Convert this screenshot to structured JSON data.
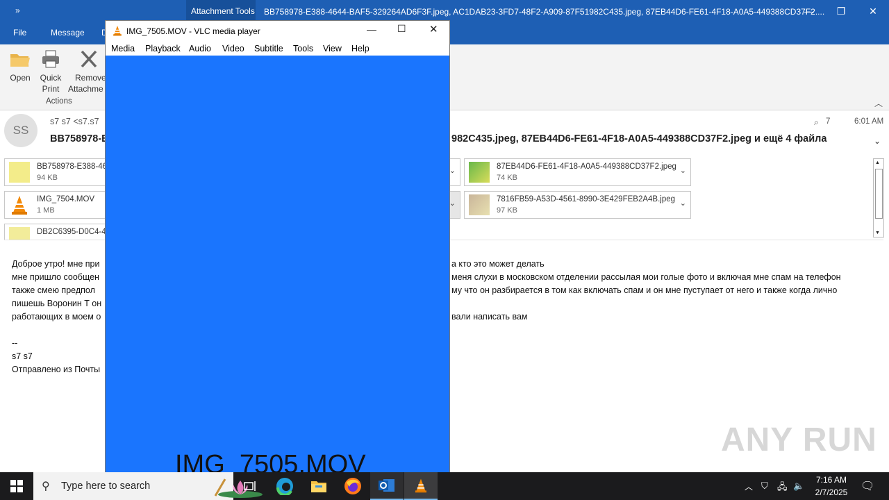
{
  "outlook": {
    "context_tab": "Attachment Tools",
    "window_title": "BB758978-E388-4644-BAF5-329264AD6F3F.jpeg, AC1DAB23-3FD7-48F2-A909-87F51982C435.jpeg, 87EB44D6-FE61-4F18-A0A5-449388CD37F2....",
    "tabs": [
      "File",
      "Message",
      "D"
    ],
    "ribbon": {
      "open": "Open",
      "quick_print_1": "Quick",
      "quick_print_2": "Print",
      "remove_1": "Remove",
      "remove_2": "Attachme",
      "group": "Actions"
    },
    "header": {
      "avatar": "SS",
      "from": "s7 s7 <s7.s7",
      "subject_left": "BB758978-E",
      "subject_right": "982C435.jpeg, 87EB44D6-FE61-4F18-A0A5-449388CD37F2.jpeg и ещё 4 файла",
      "attach_count": "7",
      "time": "6:01 AM"
    },
    "attachments": [
      {
        "name": "BB758978-E388-464",
        "size": "94 KB"
      },
      {
        "name": "IMG_7504.MOV",
        "size": "1 MB"
      },
      {
        "name": "DB2C6395-D0C4-4",
        "size": ""
      },
      {
        "name": "87EB44D6-FE61-4F18-A0A5-449388CD37F2.jpeg",
        "size": "74 KB"
      },
      {
        "name": "7816FB59-A53D-4561-8990-3E429FEB2A4B.jpeg",
        "size": "97 KB"
      }
    ],
    "body": {
      "l1a": "Доброе утро! мне при",
      "l1b": "а кто это может делать",
      "l2a": "мне пришло сообщен",
      "l2b": "меня слухи в  московском отделении рассылая мои голые фото и включая мне спам на телефон",
      "l3a": "также смею предпол",
      "l3b": "му что он разбирается в том как включать спам и он мне пуступает от него и также когда лично",
      "l4a": "пишешь Воронин Т он",
      "l5a": "работающих в моем о",
      "l5b": "вали написать вам",
      "sig1": "--",
      "sig2": "s7 s7",
      "sig3": "Отправлено из Почты"
    }
  },
  "vlc": {
    "title": "IMG_7505.MOV - VLC media player",
    "menu": [
      "Media",
      "Playback",
      "Audio",
      "Video",
      "Subtitle",
      "Tools",
      "View",
      "Help"
    ],
    "caption": "IMG_7505.MOV",
    "video_color": "#1a75fe"
  },
  "taskbar": {
    "search_placeholder": "Type here to search",
    "time": "7:16 AM",
    "date": "2/7/2025"
  },
  "watermark": "ANY RUN"
}
